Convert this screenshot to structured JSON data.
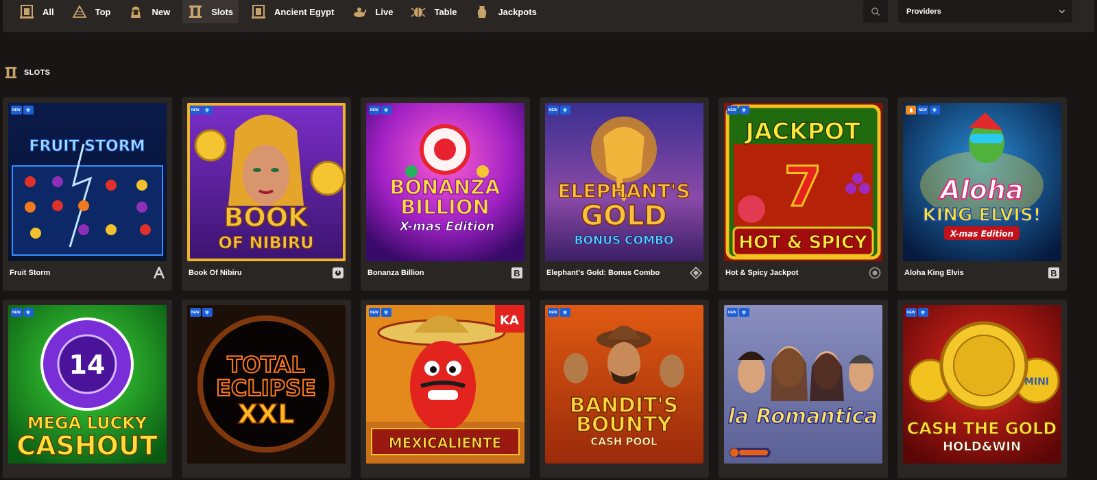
{
  "nav": {
    "items": [
      {
        "label": "All",
        "icon": "egypt-frame-icon"
      },
      {
        "label": "Top",
        "icon": "pyramid-icon"
      },
      {
        "label": "New",
        "icon": "pharaoh-icon"
      },
      {
        "label": "Slots",
        "icon": "columns-icon",
        "active": true
      },
      {
        "label": "Ancient Egypt",
        "icon": "egypt-frame-icon"
      },
      {
        "label": "Live",
        "icon": "genie-lamp-icon"
      },
      {
        "label": "Table",
        "icon": "scarab-icon"
      },
      {
        "label": "Jackpots",
        "icon": "urn-icon"
      }
    ],
    "providers_label": "Providers",
    "search_icon": "search-icon"
  },
  "section": {
    "title": "SLOTS",
    "icon": "columns-icon"
  },
  "badges": {
    "new": "NEW"
  },
  "games": [
    {
      "name": "Fruit Storm",
      "art_title_1": "FRUIT STORM",
      "provider_icon": "provider-a-icon"
    },
    {
      "name": "Book Of Nibiru",
      "art_title_1": "BOOK",
      "art_title_2": "OF NIBIRU",
      "provider_icon": "provider-round-icon"
    },
    {
      "name": "Bonanza Billion",
      "art_title_1": "BONANZA",
      "art_title_2": "BILLION",
      "art_title_3": "X-mas Edition",
      "provider_icon": "provider-b-icon"
    },
    {
      "name": "Elephant's Gold: Bonus Combo",
      "art_title_1": "ELEPHANT'S",
      "art_title_2": "GOLD",
      "art_title_3": "BONUS COMBO",
      "provider_icon": "provider-diamond-icon"
    },
    {
      "name": "Hot & Spicy Jackpot",
      "art_title_1": "JACKPOT",
      "art_title_2": "HOT & SPICY",
      "provider_icon": "provider-circle-icon"
    },
    {
      "name": "Aloha King Elvis",
      "art_title_1": "Aloha",
      "art_title_2": "KING ELVIS!",
      "art_title_3": "X-mas Edition",
      "provider_icon": "provider-b-icon"
    },
    {
      "name": "Mega Lucky Cashout",
      "art_title_1": "MEGA LUCKY",
      "art_title_2": "CASHOUT",
      "art_title_3": "14"
    },
    {
      "name": "Total Eclipse XXL",
      "art_title_1": "TOTAL",
      "art_title_2": "ECLIPSE",
      "art_title_3": "XXL"
    },
    {
      "name": "Mexicaliente",
      "art_title_1": "MEXICALIENTE",
      "art_title_2": "KA"
    },
    {
      "name": "Bandit's Bounty Cash Pool",
      "art_title_1": "BANDIT'S",
      "art_title_2": "BOUNTY",
      "art_title_3": "CASH POOL"
    },
    {
      "name": "La Romantica",
      "art_title_1": "la Romantica"
    },
    {
      "name": "Cash the Gold Hold&Win",
      "art_title_1": "CASH THE GOLD",
      "art_title_2": "HOLD&WIN",
      "art_title_3": "MINI"
    }
  ]
}
